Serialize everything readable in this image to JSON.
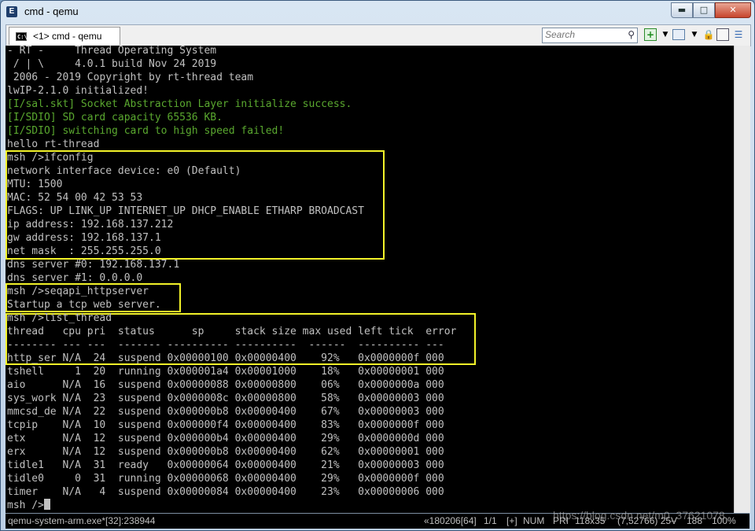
{
  "window": {
    "title": "cmd - qemu",
    "app_icon_glyph": "E",
    "controls": [
      "minimize",
      "maximize",
      "close"
    ]
  },
  "tabbar": {
    "tab_label": "<1> cmd - qemu",
    "search_placeholder": "Search"
  },
  "console": {
    "lines": [
      {
        "text": "- RT -     Thread Operating System",
        "color": "default"
      },
      {
        "text": " / | \\     4.0.1 build Nov 24 2019",
        "color": "default"
      },
      {
        "text": " 2006 - 2019 Copyright by rt-thread team",
        "color": "default"
      },
      {
        "text": "lwIP-2.1.0 initialized!",
        "color": "default"
      },
      {
        "text": "[I/sal.skt] Socket Abstraction Layer initialize success.",
        "color": "green"
      },
      {
        "text": "[I/SDIO] SD card capacity 65536 KB.",
        "color": "green"
      },
      {
        "text": "[I/SDIO] switching card to high speed failed!",
        "color": "green"
      },
      {
        "text": "hello rt-thread",
        "color": "default"
      },
      {
        "text": "msh />ifconfig",
        "color": "default"
      },
      {
        "text": "network interface device: e0 (Default)",
        "color": "default"
      },
      {
        "text": "MTU: 1500",
        "color": "default"
      },
      {
        "text": "MAC: 52 54 00 42 53 53",
        "color": "default"
      },
      {
        "text": "FLAGS: UP LINK_UP INTERNET_UP DHCP_ENABLE ETHARP BROADCAST",
        "color": "default"
      },
      {
        "text": "ip address: 192.168.137.212",
        "color": "default"
      },
      {
        "text": "gw address: 192.168.137.1",
        "color": "default"
      },
      {
        "text": "net mask  : 255.255.255.0",
        "color": "default"
      },
      {
        "text": "dns server #0: 192.168.137.1",
        "color": "default"
      },
      {
        "text": "dns server #1: 0.0.0.0",
        "color": "default"
      },
      {
        "text": "msh />seqapi_httpserver",
        "color": "default"
      },
      {
        "text": "Startup a tcp web server.",
        "color": "default"
      },
      {
        "text": "msh />list_thread",
        "color": "default"
      },
      {
        "text": "thread   cpu pri  status      sp     stack size max used left tick  error",
        "color": "default"
      },
      {
        "text": "-------- --- ---  ------- ---------- ----------  ------  ---------- ---",
        "color": "default"
      },
      {
        "text": "http_ser N/A  24  suspend 0x00000100 0x00000400    92%   0x0000000f 000",
        "color": "default"
      },
      {
        "text": "tshell     1  20  running 0x000001a4 0x00001000    18%   0x00000001 000",
        "color": "default"
      },
      {
        "text": "aio      N/A  16  suspend 0x00000088 0x00000800    06%   0x0000000a 000",
        "color": "default"
      },
      {
        "text": "sys_work N/A  23  suspend 0x0000008c 0x00000800    58%   0x00000003 000",
        "color": "default"
      },
      {
        "text": "mmcsd_de N/A  22  suspend 0x000000b8 0x00000400    67%   0x00000003 000",
        "color": "default"
      },
      {
        "text": "tcpip    N/A  10  suspend 0x000000f4 0x00000400    83%   0x0000000f 000",
        "color": "default"
      },
      {
        "text": "etx      N/A  12  suspend 0x000000b4 0x00000400    29%   0x0000000d 000",
        "color": "default"
      },
      {
        "text": "erx      N/A  12  suspend 0x000000b8 0x00000400    62%   0x00000001 000",
        "color": "default"
      },
      {
        "text": "tidle1   N/A  31  ready   0x00000064 0x00000400    21%   0x00000003 000",
        "color": "default"
      },
      {
        "text": "tidle0     0  31  running 0x00000068 0x00000400    29%   0x0000000f 000",
        "color": "default"
      },
      {
        "text": "timer    N/A   4  suspend 0x00000084 0x00000400    23%   0x00000006 000",
        "color": "default"
      },
      {
        "text": "msh />",
        "color": "default"
      }
    ],
    "highlight_color": "#f2f229",
    "text_color": "#c0c0c0",
    "green_color": "#5aa82f"
  },
  "statusbar": {
    "process": "qemu-system-arm.exe*[32]:238944",
    "position": "«180206[64]",
    "pages": "1/1",
    "plus": "[+]",
    "num": "NUM",
    "pri": "PRI",
    "size": "118x35",
    "coords": "(7,52766) 25V",
    "extra": "188",
    "zoom": "100%"
  },
  "watermark": "https://blog.csdn.net/m0_37621078"
}
